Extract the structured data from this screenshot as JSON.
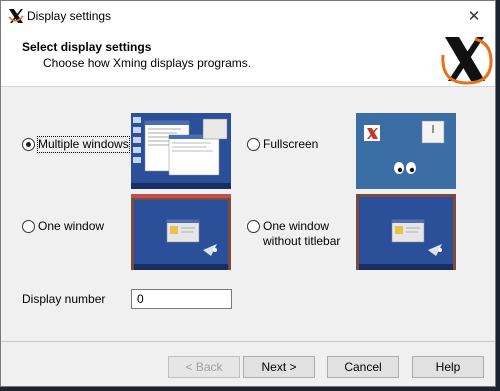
{
  "window": {
    "title": "Display settings",
    "close_glyph": "✕",
    "header_title": "Select display settings",
    "header_subtitle": "Choose how Xming displays programs."
  },
  "options": {
    "multiple_windows": {
      "label": "Multiple windows",
      "selected": true
    },
    "fullscreen": {
      "label": "Fullscreen",
      "selected": false
    },
    "one_window": {
      "label": "One window",
      "selected": false
    },
    "one_window_no_titlebar": {
      "label_line1": "One window",
      "label_line2": "without titlebar",
      "selected": false
    }
  },
  "display_number": {
    "label": "Display number",
    "value": "0"
  },
  "buttons": {
    "back": "< Back",
    "next": "Next >",
    "cancel": "Cancel",
    "help": "Help"
  },
  "colors": {
    "accent": "#0078d7",
    "xming_orange": "#e8701a",
    "desktop_blue": "#2c4f9a",
    "preview_blue": "#3a6ea5"
  },
  "icons": [
    "xming-x-icon",
    "close-icon",
    "xming-logo",
    "radio-icon"
  ]
}
